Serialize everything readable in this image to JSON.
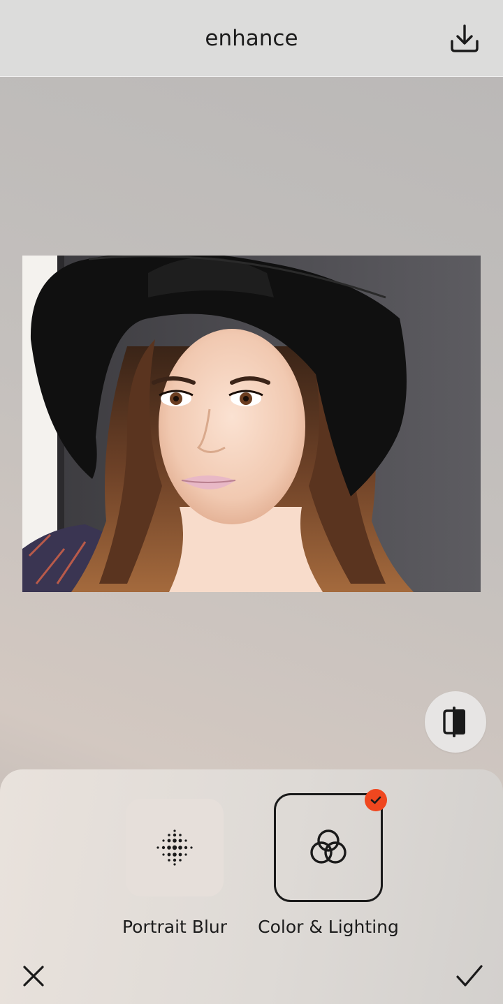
{
  "header": {
    "title": "enhance",
    "download_icon": "download-icon"
  },
  "photo": {
    "description_icon": "portrait-photo"
  },
  "compare": {
    "icon": "compare-icon"
  },
  "tools": [
    {
      "label": "Portrait Blur",
      "icon": "dots-grid-icon",
      "selected": false
    },
    {
      "label": "Color & Lighting",
      "icon": "intertwined-rings-icon",
      "selected": true
    }
  ],
  "footer": {
    "close_icon": "close-icon",
    "confirm_icon": "check-icon"
  },
  "colors": {
    "accent": "#f0471f",
    "text": "#1c1c1c",
    "header_bg": "#dcdcdb"
  }
}
